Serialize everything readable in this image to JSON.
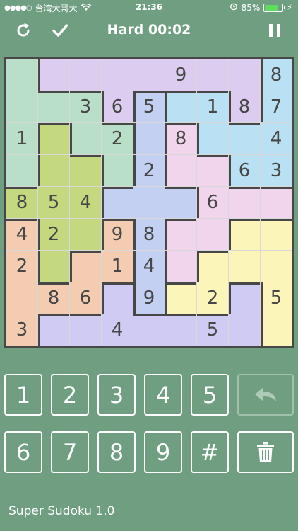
{
  "status_bar": {
    "carrier": "台湾大哥大",
    "time": "21:36",
    "battery_percent": "85%",
    "battery_level": 0.85,
    "icons": [
      "signal-dots-icon",
      "wifi-icon",
      "alarm-icon",
      "battery-icon",
      "charging-bolt-icon"
    ]
  },
  "nav": {
    "title": "Hard 00:02",
    "icons": [
      "refresh-icon",
      "checkmark-icon",
      "pause-icon"
    ]
  },
  "colors": {
    "background": "#6f9f80",
    "border": "#474747",
    "digit": "#474747",
    "regions": {
      "A": "#b9dfc9",
      "B": "#dccdf0",
      "C": "#b9e1f3",
      "D": "#c3d87f",
      "E": "#c4d0f2",
      "F": "#f1d5ec",
      "G": "#f4ccb2",
      "H": "#fbf5b9",
      "I": "#d0cbf2"
    }
  },
  "board": {
    "regions": [
      [
        "A",
        "B",
        "B",
        "B",
        "B",
        "B",
        "B",
        "B",
        "C"
      ],
      [
        "A",
        "A",
        "A",
        "B",
        "E",
        "C",
        "C",
        "B",
        "C"
      ],
      [
        "A",
        "D",
        "A",
        "A",
        "E",
        "F",
        "C",
        "C",
        "C"
      ],
      [
        "A",
        "D",
        "D",
        "A",
        "E",
        "F",
        "F",
        "C",
        "C"
      ],
      [
        "D",
        "D",
        "D",
        "E",
        "E",
        "E",
        "F",
        "F",
        "F"
      ],
      [
        "G",
        "D",
        "D",
        "G",
        "E",
        "F",
        "F",
        "H",
        "H"
      ],
      [
        "G",
        "D",
        "G",
        "G",
        "E",
        "F",
        "H",
        "H",
        "H"
      ],
      [
        "G",
        "G",
        "G",
        "I",
        "E",
        "H",
        "H",
        "I",
        "H"
      ],
      [
        "G",
        "I",
        "I",
        "I",
        "I",
        "I",
        "I",
        "I",
        "H"
      ]
    ],
    "values": [
      [
        "",
        "",
        "",
        "",
        "",
        "9",
        "",
        "",
        "8"
      ],
      [
        "",
        "",
        "3",
        "6",
        "5",
        "",
        "1",
        "8",
        "7"
      ],
      [
        "1",
        "",
        "",
        "2",
        "",
        "8",
        "",
        "",
        "4"
      ],
      [
        "",
        "",
        "",
        "",
        "2",
        "",
        "",
        "6",
        "3"
      ],
      [
        "8",
        "5",
        "4",
        "",
        "",
        "",
        "6",
        "",
        ""
      ],
      [
        "4",
        "2",
        "",
        "9",
        "8",
        "",
        "",
        "",
        ""
      ],
      [
        "2",
        "",
        "",
        "1",
        "4",
        "",
        "",
        "",
        ""
      ],
      [
        "",
        "8",
        "6",
        "",
        "9",
        "",
        "2",
        "",
        "5"
      ],
      [
        "3",
        "",
        "",
        "4",
        "",
        "",
        "5",
        "",
        ""
      ]
    ]
  },
  "keypad": {
    "row1": [
      "1",
      "2",
      "3",
      "4",
      "5"
    ],
    "row2": [
      "6",
      "7",
      "8",
      "9",
      "#"
    ],
    "undo_icon": "undo-icon",
    "delete_icon": "trash-icon"
  },
  "footer": {
    "app_name": "Super Sudoku 1.0"
  }
}
